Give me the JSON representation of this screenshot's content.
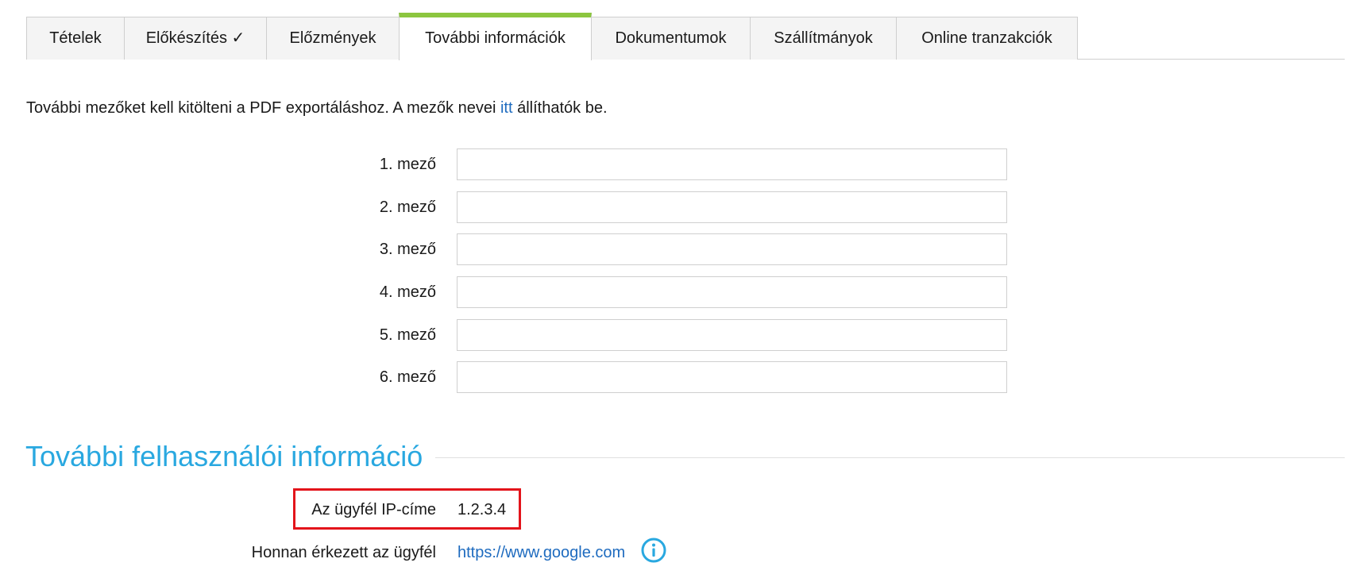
{
  "tabs": [
    {
      "label": "Tételek"
    },
    {
      "label": "Előkészítés ✓"
    },
    {
      "label": "Előzmények"
    },
    {
      "label": "További információk",
      "active": true
    },
    {
      "label": "Dokumentumok"
    },
    {
      "label": "Szállítmányok"
    },
    {
      "label": "Online tranzakciók"
    }
  ],
  "intro": {
    "text_before": "További mezőket kell kitölteni a PDF exportáláshoz. A mezők nevei ",
    "link": "itt",
    "text_after": " állíthatók be."
  },
  "fields": [
    {
      "label": "1. mező",
      "value": ""
    },
    {
      "label": "2. mező",
      "value": ""
    },
    {
      "label": "3. mező",
      "value": ""
    },
    {
      "label": "4. mező",
      "value": ""
    },
    {
      "label": "5. mező",
      "value": ""
    },
    {
      "label": "6. mező",
      "value": ""
    }
  ],
  "section": {
    "title": "További felhasználói információ"
  },
  "user_info": {
    "ip_label": "Az ügyfél IP-címe",
    "ip_value": "1.2.3.4",
    "referrer_label": "Honnan érkezett az ügyfél",
    "referrer_value": "https://www.google.com",
    "info_icon": "info-circle-icon"
  },
  "colors": {
    "active_tab_accent": "#8cc63f",
    "section_title": "#29a8e0",
    "link": "#1e6bbf",
    "highlight": "#e3141b"
  }
}
